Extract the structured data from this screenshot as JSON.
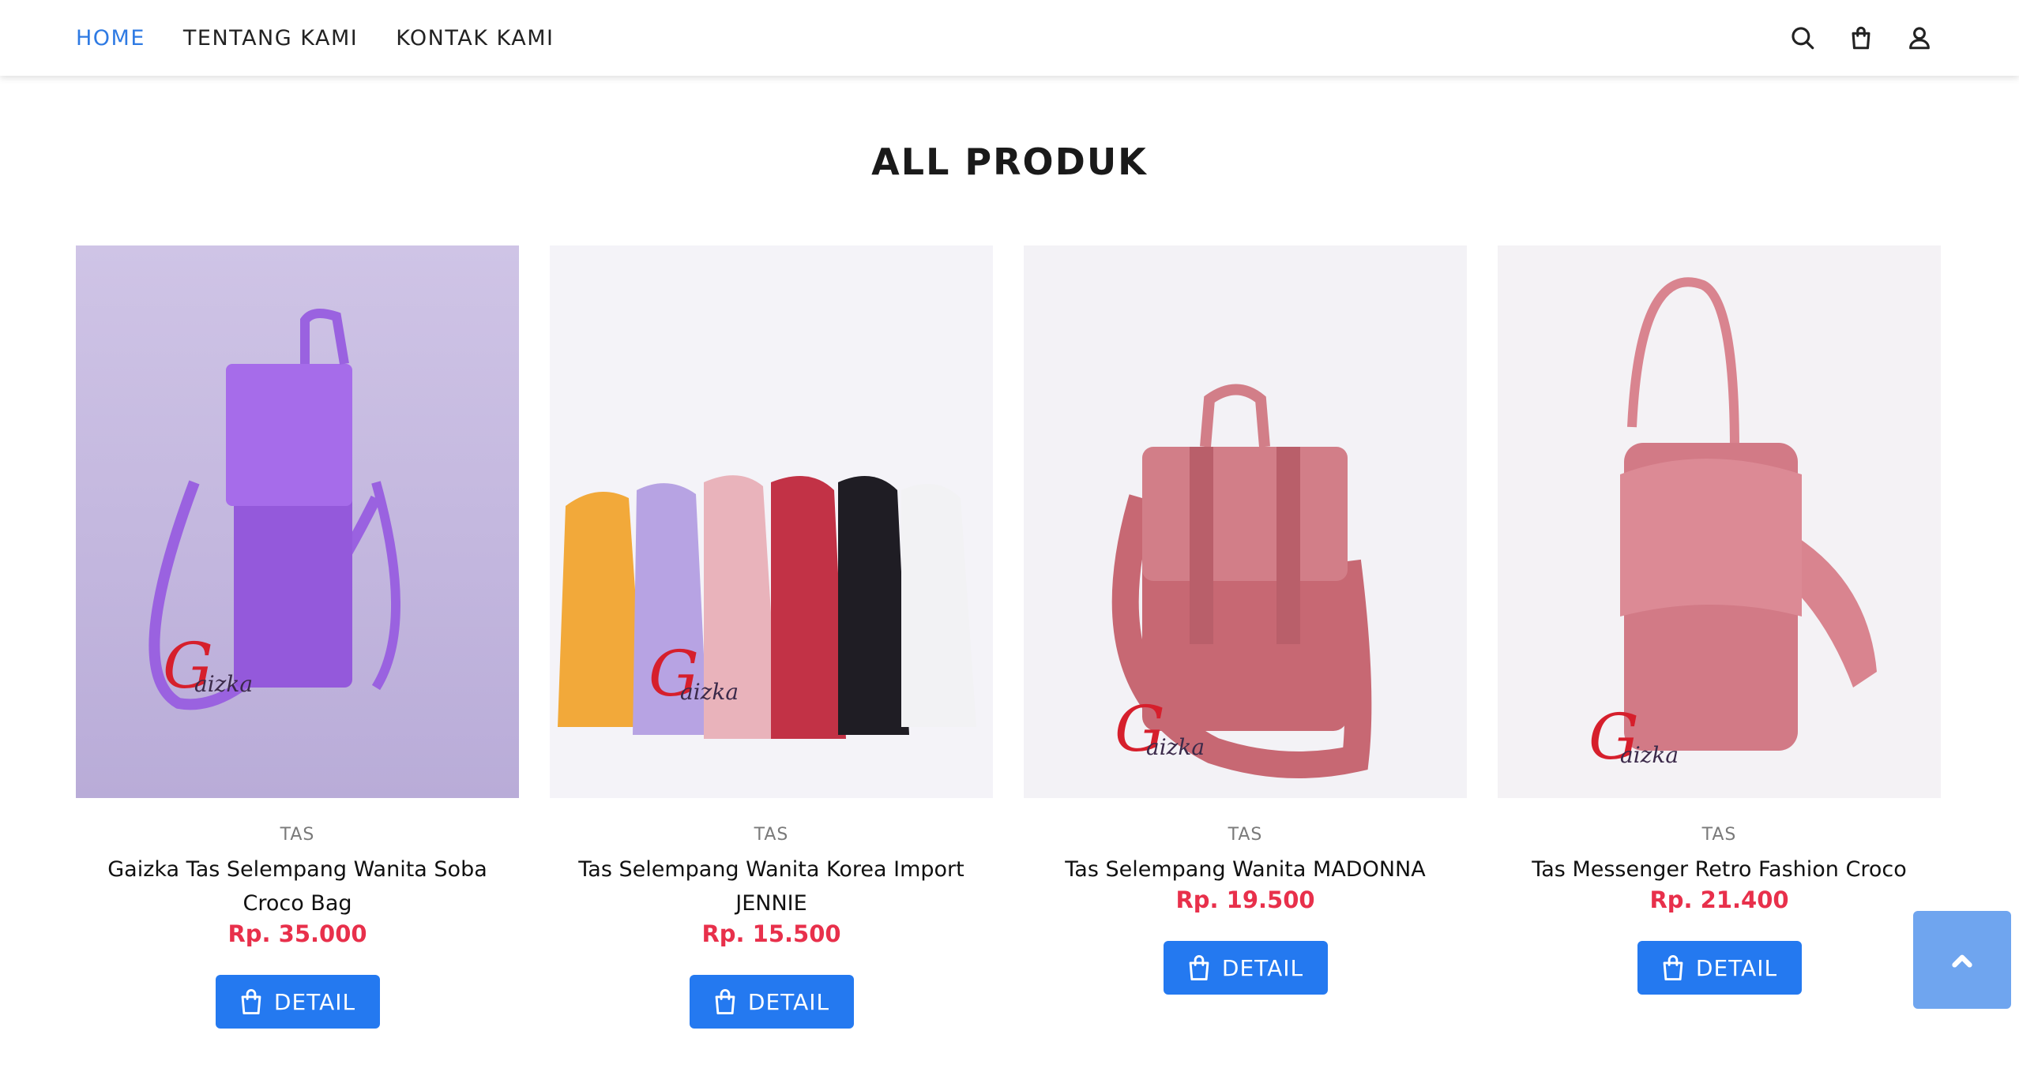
{
  "nav": {
    "links": [
      {
        "label": "HOME",
        "active": true
      },
      {
        "label": "TENTANG KAMI",
        "active": false
      },
      {
        "label": "KONTAK KAMI",
        "active": false
      }
    ],
    "icons": [
      "search-icon",
      "shopping-bag-icon",
      "user-icon"
    ]
  },
  "section": {
    "title": "ALL PRODUK"
  },
  "products": [
    {
      "category": "TAS",
      "name": "Gaizka Tas Selempang Wanita Soba Croco Bag",
      "price": "Rp. 35.000",
      "button": "DETAIL",
      "watermark": "aizka",
      "color": "#9a62e0"
    },
    {
      "category": "TAS",
      "name": "Tas Selempang Wanita Korea Import JENNIE",
      "price": "Rp. 15.500",
      "button": "DETAIL",
      "watermark": "aizka",
      "color": "#f2a93a"
    },
    {
      "category": "TAS",
      "name": "Tas Selempang Wanita MADONNA",
      "price": "Rp. 19.500",
      "button": "DETAIL",
      "watermark": "aizka",
      "color": "#c76873"
    },
    {
      "category": "TAS",
      "name": "Tas Messenger Retro Fashion Croco",
      "price": "Rp. 21.400",
      "button": "DETAIL",
      "watermark": "aizka",
      "color": "#d9848f"
    }
  ],
  "colors": {
    "accent": "#2479f0",
    "price": "#e8304b",
    "nav_active": "#2e7ae3"
  }
}
